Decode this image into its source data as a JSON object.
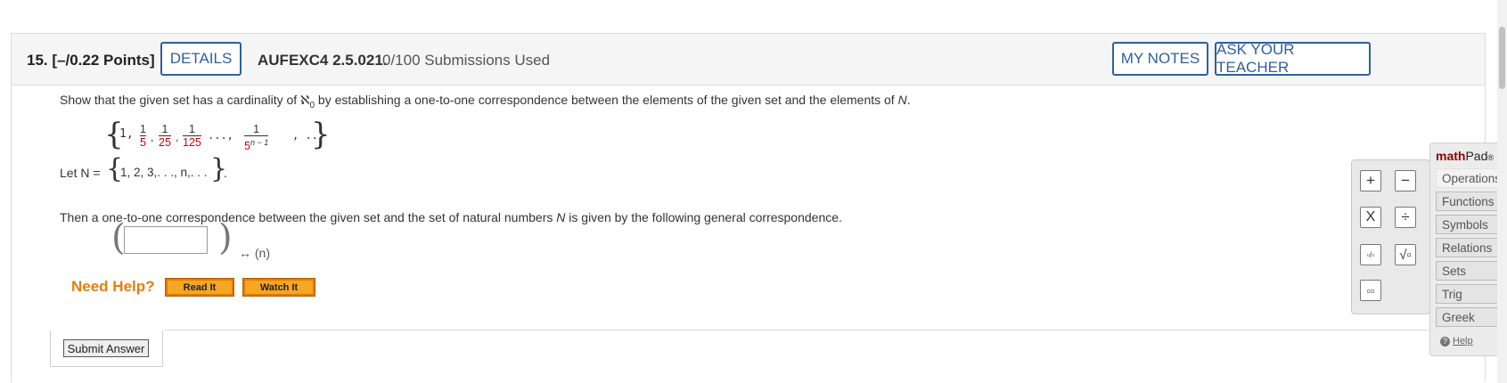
{
  "header": {
    "question_number": "15.",
    "points": "[–/0.22 Points]",
    "details_label": "DETAILS",
    "question_code": "AUFEXC4 2.5.021.",
    "submissions": "0/100 Submissions Used",
    "my_notes_label": "MY NOTES",
    "ask_teacher_label": "ASK YOUR TEACHER"
  },
  "question": {
    "prompt_a": "Show that the given set has a cardinality of ℵ",
    "prompt_sub": "0",
    "prompt_b": " by establishing a one-to-one correspondence between the elements of the given set and the elements of ",
    "prompt_n": "N",
    "prompt_end": ".",
    "set": {
      "first": "1,",
      "terms": [
        {
          "num": "1",
          "den": "5"
        },
        {
          "num": "1",
          "den": "25"
        },
        {
          "num": "1",
          "den": "125"
        }
      ],
      "ellipsis": "...,",
      "general": {
        "num": "1",
        "den_base": "5",
        "den_exp": "n − 1"
      },
      "tail": ", ..."
    },
    "let_label": "Let N =",
    "let_set": "1, 2, 3,. . ., n,. . .",
    "let_end": ".",
    "correspondence_text_a": "Then a one-to-one correspondence between the given set and the set of natural numbers ",
    "correspondence_text_n": "N",
    "correspondence_text_b": " is given by the following general correspondence.",
    "answer_value": "",
    "arrow_text": "↔ (n)"
  },
  "help": {
    "need_help_label": "Need Help?",
    "read_it": "Read It",
    "watch_it": "Watch It"
  },
  "submit_label": "Submit Answer",
  "mathpad": {
    "logo_main": "math",
    "logo_pad": "Pad",
    "logo_mark": "®",
    "keys": [
      "+",
      "−",
      "X",
      "÷",
      "▫/▫",
      "√▫",
      "▫▫"
    ],
    "tabs": [
      "Operations",
      "Functions",
      "Symbols",
      "Relations",
      "Sets",
      "Trig",
      "Greek"
    ],
    "help_label": "Help"
  },
  "colors": {
    "accent_blue": "#2f5f9e",
    "need_help_orange": "#e87c0b",
    "fraction_red": "#cc0000"
  }
}
